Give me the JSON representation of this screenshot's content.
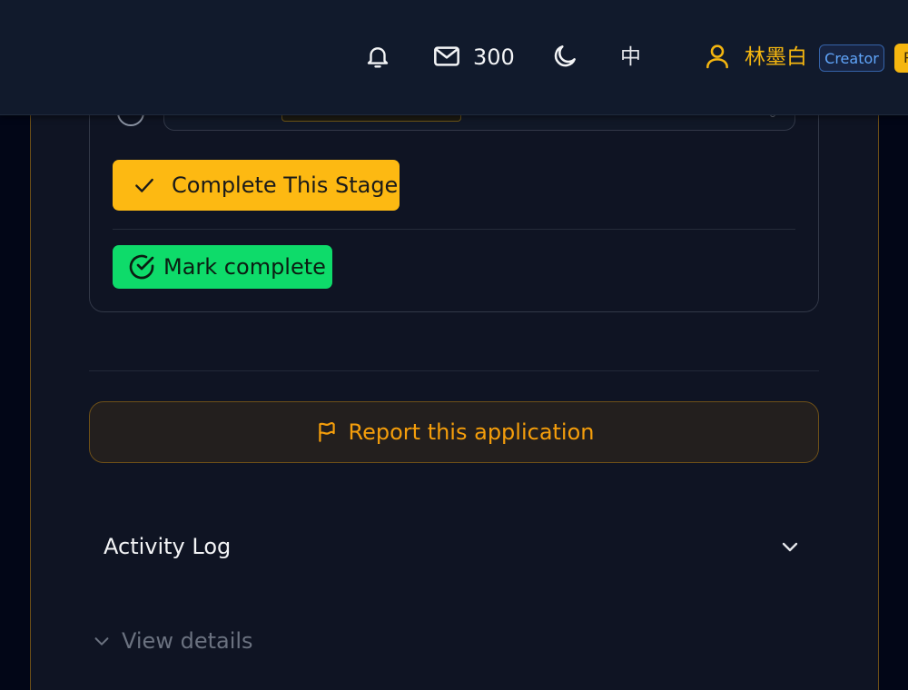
{
  "header": {
    "mail_count": "300",
    "language_label": "中",
    "username": "林墨白",
    "badges": {
      "creator": "Creator",
      "role": "P"
    },
    "icons": {
      "notifications": "bell-icon",
      "messages": "mail-icon",
      "theme": "moon-icon",
      "user": "user-icon"
    },
    "colors": {
      "background": "#111a2c",
      "accent": "#f5b60f"
    }
  },
  "stage": {
    "complete_stage_label": "Complete This Stage",
    "mark_complete_label": "Mark complete",
    "colors": {
      "complete_stage_bg": "#fdb912",
      "mark_complete_bg": "#0edb6a"
    }
  },
  "report": {
    "label": "Report this application",
    "icon": "flag-icon",
    "color": "#f59e0b"
  },
  "activity_log": {
    "title": "Activity Log",
    "view_details_label": "View details"
  }
}
